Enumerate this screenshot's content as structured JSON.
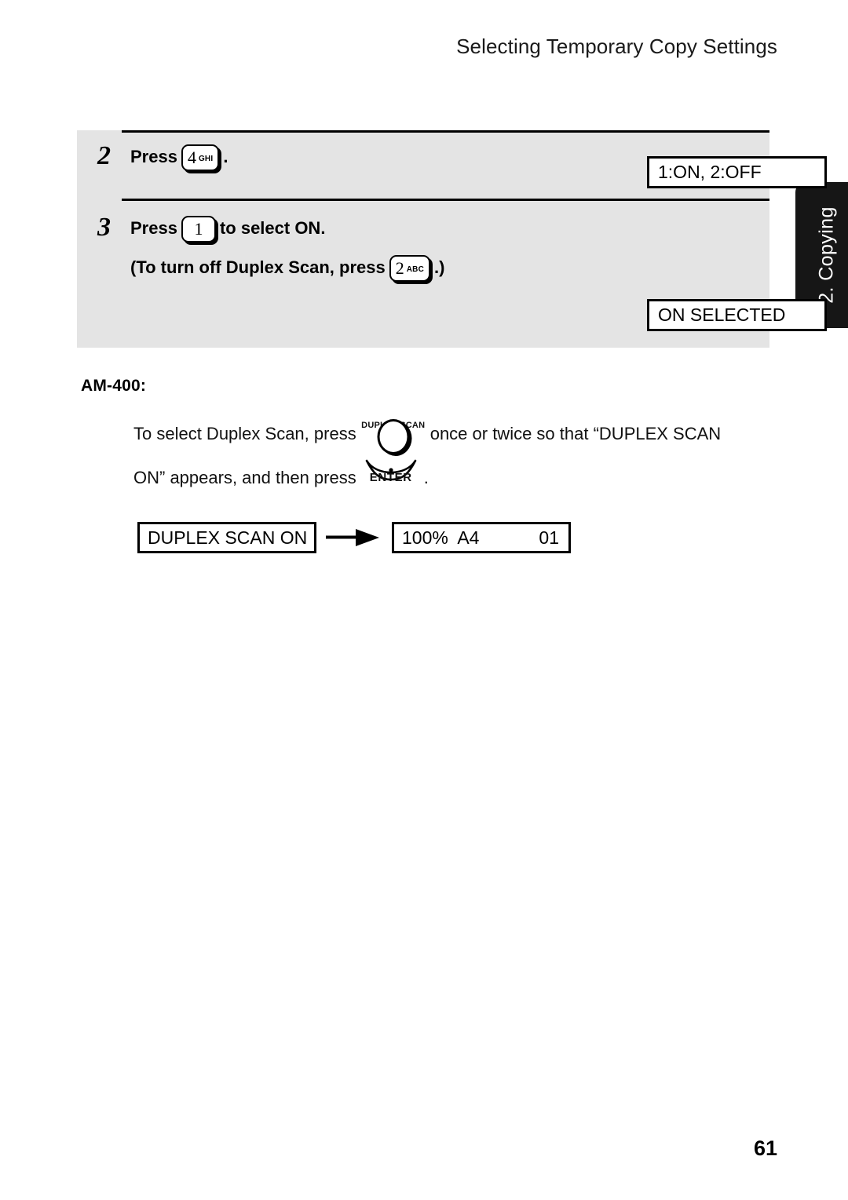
{
  "header": {
    "title": "Selecting Temporary Copy Settings"
  },
  "side_tab": {
    "label": "2. Copying",
    "background_color": "#161616",
    "text_color": "#ffffff"
  },
  "step_panel": {
    "background_color": "#e4e4e4",
    "steps": [
      {
        "number": "2",
        "line1_prefix": "Press",
        "key": {
          "digit": "4",
          "letters": "GHI"
        },
        "line1_suffix": ".",
        "lcd": "1:ON, 2:OFF"
      },
      {
        "number": "3",
        "line1_prefix": "Press",
        "key": {
          "digit": "1",
          "letters": ""
        },
        "line1_suffix": "to select ON.",
        "line2_prefix": "(To turn off Duplex Scan, press",
        "line2_key": {
          "digit": "2",
          "letters": "ABC"
        },
        "line2_suffix": ".)",
        "lcd": "ON SELECTED"
      }
    ]
  },
  "am400": {
    "label": "AM-400:",
    "line1_prefix": "To select Duplex Scan, press",
    "duplex_button_label": "DUPLEX SCAN",
    "line1_suffix": "once or twice so that “DUPLEX SCAN",
    "line2_prefix": "ON” appears, and then press",
    "enter_button_label": "ENTER",
    "line2_suffix": "."
  },
  "flow": {
    "display_before": "DUPLEX SCAN ON",
    "arrow_icon": "right-arrow-icon",
    "display_after_left": "100%  A4",
    "display_after_right": "01"
  },
  "footer": {
    "page_number": "61"
  }
}
